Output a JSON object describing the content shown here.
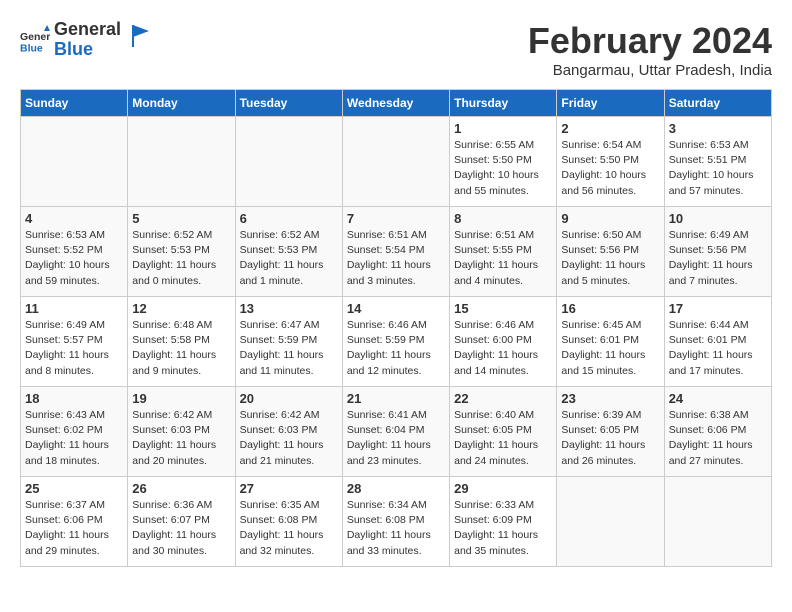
{
  "header": {
    "logo_line1": "General",
    "logo_line2": "Blue",
    "month_title": "February 2024",
    "subtitle": "Bangarmau, Uttar Pradesh, India"
  },
  "days_of_week": [
    "Sunday",
    "Monday",
    "Tuesday",
    "Wednesday",
    "Thursday",
    "Friday",
    "Saturday"
  ],
  "weeks": [
    [
      {
        "day": "",
        "info": ""
      },
      {
        "day": "",
        "info": ""
      },
      {
        "day": "",
        "info": ""
      },
      {
        "day": "",
        "info": ""
      },
      {
        "day": "1",
        "info": "Sunrise: 6:55 AM\nSunset: 5:50 PM\nDaylight: 10 hours\nand 55 minutes."
      },
      {
        "day": "2",
        "info": "Sunrise: 6:54 AM\nSunset: 5:50 PM\nDaylight: 10 hours\nand 56 minutes."
      },
      {
        "day": "3",
        "info": "Sunrise: 6:53 AM\nSunset: 5:51 PM\nDaylight: 10 hours\nand 57 minutes."
      }
    ],
    [
      {
        "day": "4",
        "info": "Sunrise: 6:53 AM\nSunset: 5:52 PM\nDaylight: 10 hours\nand 59 minutes."
      },
      {
        "day": "5",
        "info": "Sunrise: 6:52 AM\nSunset: 5:53 PM\nDaylight: 11 hours\nand 0 minutes."
      },
      {
        "day": "6",
        "info": "Sunrise: 6:52 AM\nSunset: 5:53 PM\nDaylight: 11 hours\nand 1 minute."
      },
      {
        "day": "7",
        "info": "Sunrise: 6:51 AM\nSunset: 5:54 PM\nDaylight: 11 hours\nand 3 minutes."
      },
      {
        "day": "8",
        "info": "Sunrise: 6:51 AM\nSunset: 5:55 PM\nDaylight: 11 hours\nand 4 minutes."
      },
      {
        "day": "9",
        "info": "Sunrise: 6:50 AM\nSunset: 5:56 PM\nDaylight: 11 hours\nand 5 minutes."
      },
      {
        "day": "10",
        "info": "Sunrise: 6:49 AM\nSunset: 5:56 PM\nDaylight: 11 hours\nand 7 minutes."
      }
    ],
    [
      {
        "day": "11",
        "info": "Sunrise: 6:49 AM\nSunset: 5:57 PM\nDaylight: 11 hours\nand 8 minutes."
      },
      {
        "day": "12",
        "info": "Sunrise: 6:48 AM\nSunset: 5:58 PM\nDaylight: 11 hours\nand 9 minutes."
      },
      {
        "day": "13",
        "info": "Sunrise: 6:47 AM\nSunset: 5:59 PM\nDaylight: 11 hours\nand 11 minutes."
      },
      {
        "day": "14",
        "info": "Sunrise: 6:46 AM\nSunset: 5:59 PM\nDaylight: 11 hours\nand 12 minutes."
      },
      {
        "day": "15",
        "info": "Sunrise: 6:46 AM\nSunset: 6:00 PM\nDaylight: 11 hours\nand 14 minutes."
      },
      {
        "day": "16",
        "info": "Sunrise: 6:45 AM\nSunset: 6:01 PM\nDaylight: 11 hours\nand 15 minutes."
      },
      {
        "day": "17",
        "info": "Sunrise: 6:44 AM\nSunset: 6:01 PM\nDaylight: 11 hours\nand 17 minutes."
      }
    ],
    [
      {
        "day": "18",
        "info": "Sunrise: 6:43 AM\nSunset: 6:02 PM\nDaylight: 11 hours\nand 18 minutes."
      },
      {
        "day": "19",
        "info": "Sunrise: 6:42 AM\nSunset: 6:03 PM\nDaylight: 11 hours\nand 20 minutes."
      },
      {
        "day": "20",
        "info": "Sunrise: 6:42 AM\nSunset: 6:03 PM\nDaylight: 11 hours\nand 21 minutes."
      },
      {
        "day": "21",
        "info": "Sunrise: 6:41 AM\nSunset: 6:04 PM\nDaylight: 11 hours\nand 23 minutes."
      },
      {
        "day": "22",
        "info": "Sunrise: 6:40 AM\nSunset: 6:05 PM\nDaylight: 11 hours\nand 24 minutes."
      },
      {
        "day": "23",
        "info": "Sunrise: 6:39 AM\nSunset: 6:05 PM\nDaylight: 11 hours\nand 26 minutes."
      },
      {
        "day": "24",
        "info": "Sunrise: 6:38 AM\nSunset: 6:06 PM\nDaylight: 11 hours\nand 27 minutes."
      }
    ],
    [
      {
        "day": "25",
        "info": "Sunrise: 6:37 AM\nSunset: 6:06 PM\nDaylight: 11 hours\nand 29 minutes."
      },
      {
        "day": "26",
        "info": "Sunrise: 6:36 AM\nSunset: 6:07 PM\nDaylight: 11 hours\nand 30 minutes."
      },
      {
        "day": "27",
        "info": "Sunrise: 6:35 AM\nSunset: 6:08 PM\nDaylight: 11 hours\nand 32 minutes."
      },
      {
        "day": "28",
        "info": "Sunrise: 6:34 AM\nSunset: 6:08 PM\nDaylight: 11 hours\nand 33 minutes."
      },
      {
        "day": "29",
        "info": "Sunrise: 6:33 AM\nSunset: 6:09 PM\nDaylight: 11 hours\nand 35 minutes."
      },
      {
        "day": "",
        "info": ""
      },
      {
        "day": "",
        "info": ""
      }
    ]
  ]
}
